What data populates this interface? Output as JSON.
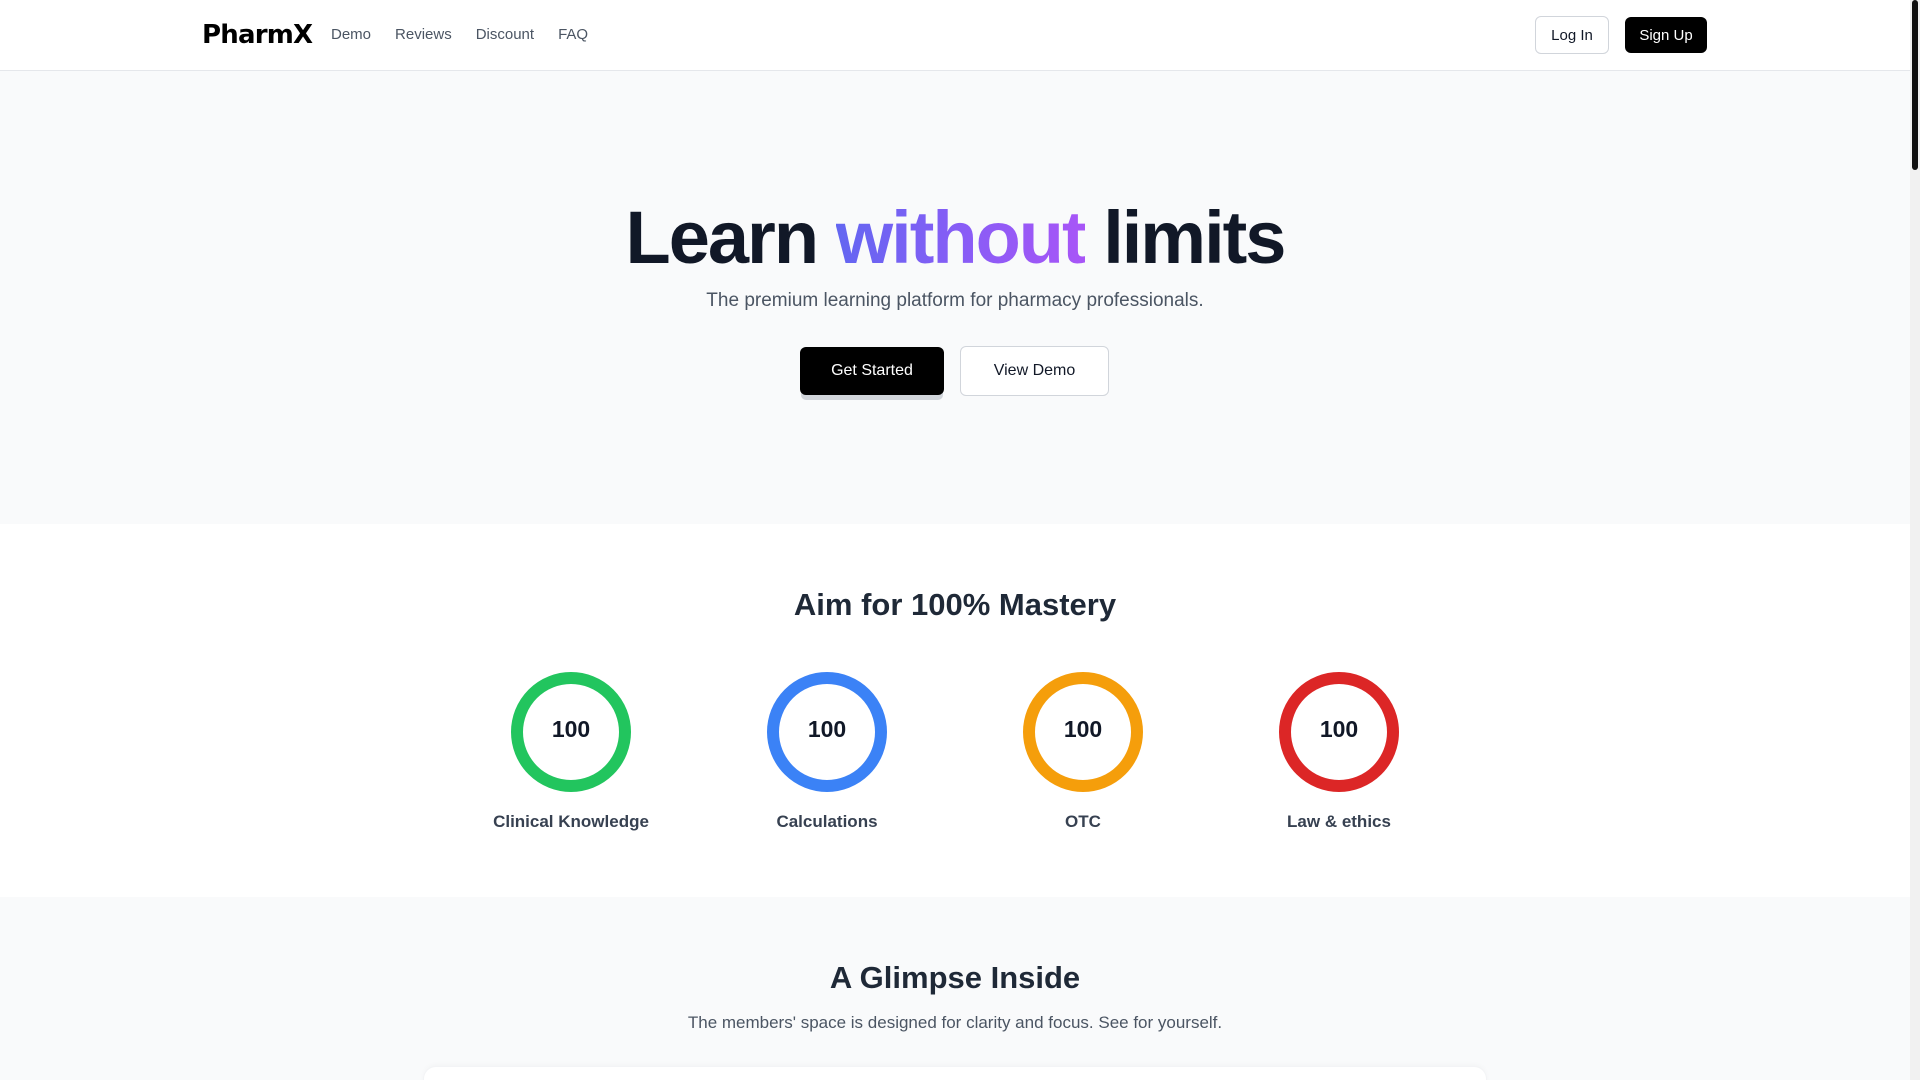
{
  "header": {
    "logo": "PharmX",
    "nav": [
      "Demo",
      "Reviews",
      "Discount",
      "FAQ"
    ],
    "login_label": "Log In",
    "signup_label": "Sign Up"
  },
  "hero": {
    "title_part1": "Learn",
    "title_accent": "without",
    "title_part2": "limits",
    "subtitle": "The premium learning platform for pharmacy professionals.",
    "primary_cta": "Get Started",
    "secondary_cta": "View Demo",
    "accent_gradient": [
      "#6366f1",
      "#a855f7"
    ]
  },
  "mastery": {
    "title": "Aim for 100% Mastery",
    "items": [
      {
        "value": "100",
        "label": "Clinical Knowledge",
        "color": "#22c55e"
      },
      {
        "value": "100",
        "label": "Calculations",
        "color": "#3b82f6"
      },
      {
        "value": "100",
        "label": "OTC",
        "color": "#f59e0b"
      },
      {
        "value": "100",
        "label": "Law & ethics",
        "color": "#dc2626"
      }
    ]
  },
  "glimpse": {
    "title": "A Glimpse Inside",
    "subtitle": "The members' space is designed for clarity and focus. See for yourself."
  }
}
